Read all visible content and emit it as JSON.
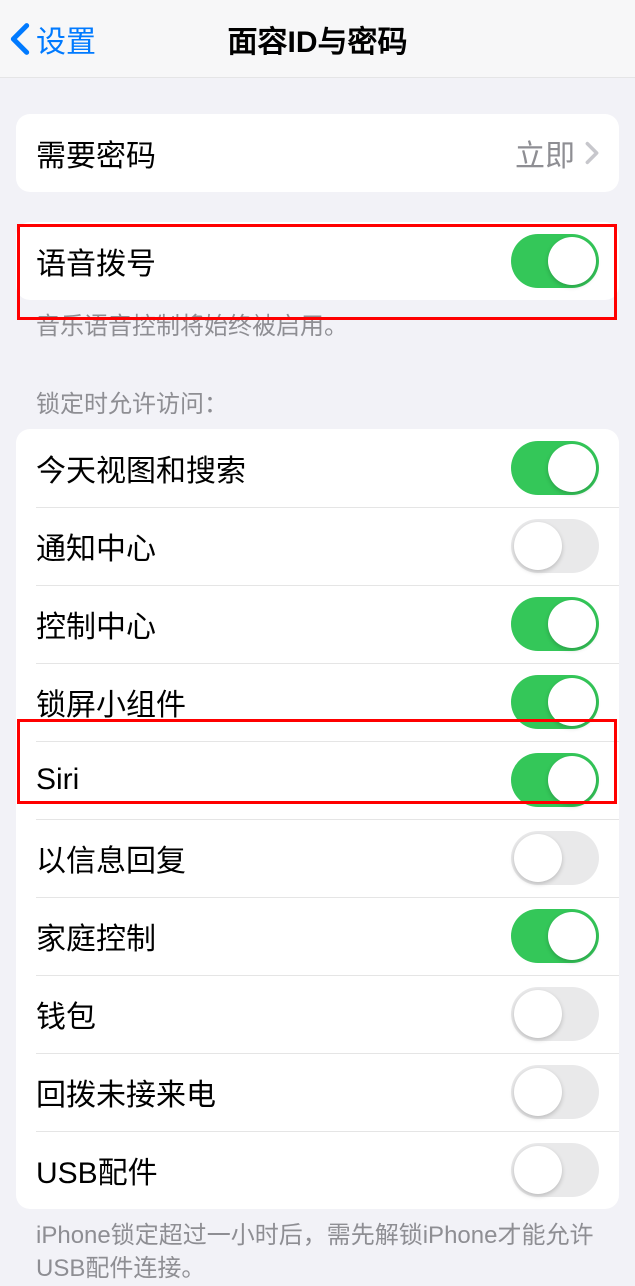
{
  "header": {
    "back_label": "设置",
    "title": "面容ID与密码"
  },
  "require_passcode": {
    "label": "需要密码",
    "value": "立即"
  },
  "voice_dial": {
    "label": "语音拨号",
    "footer": "音乐语音控制将始终被启用。"
  },
  "lock_section": {
    "header": "锁定时允许访问：",
    "items": [
      {
        "label": "今天视图和搜索",
        "on": true
      },
      {
        "label": "通知中心",
        "on": false
      },
      {
        "label": "控制中心",
        "on": true
      },
      {
        "label": "锁屏小组件",
        "on": true
      },
      {
        "label": "Siri",
        "on": true
      },
      {
        "label": "以信息回复",
        "on": false
      },
      {
        "label": "家庭控制",
        "on": true
      },
      {
        "label": "钱包",
        "on": false
      },
      {
        "label": "回拨未接来电",
        "on": false
      },
      {
        "label": "USB配件",
        "on": false
      }
    ],
    "footer": "iPhone锁定超过一小时后，需先解锁iPhone才能允许USB配件连接。"
  }
}
